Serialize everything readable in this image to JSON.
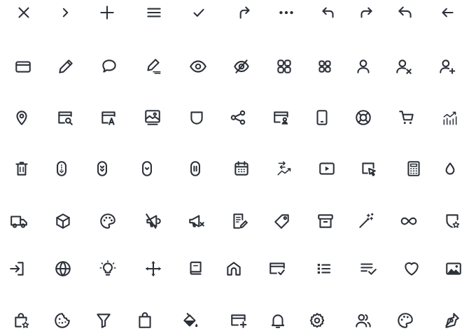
{
  "colors": {
    "background": "#ffffff",
    "icon_stroke": "#2c3038"
  },
  "icon_grid": {
    "rows": [
      [
        "close-icon",
        "chevron-right-icon",
        "plus-icon",
        "menu-icon",
        "check-icon",
        "corner-up-right-icon",
        "more-horizontal-icon",
        "undo-icon",
        "redo-icon",
        "reply-icon",
        "arrow-left-icon"
      ],
      [
        "credit-card-icon",
        "pencil-icon",
        "comment-icon",
        "signature-icon",
        "eye-icon",
        "eye-off-icon",
        "grid-2x2-icon",
        "grid-2x2-small-icon",
        "user-icon",
        "user-remove-icon",
        "user-add-icon"
      ],
      [
        "map-pin-icon",
        "browser-search-icon",
        "browser-text-icon",
        "monitor-image-icon",
        "shield-icon",
        "share-icon",
        "id-card-user-icon",
        "smartphone-icon",
        "lifebuoy-icon",
        "shopping-cart-icon",
        "bar-chart-trend-icon"
      ],
      [
        "trash-icon",
        "scroll-down-icon",
        "scroll-chevrons-icon",
        "scroll-chevron-icon",
        "scroll-pause-icon",
        "calendar-icon",
        "transfer-trend-icon",
        "video-play-icon",
        "cursor-click-icon",
        "calculator-icon",
        "drop-icon"
      ],
      [
        "truck-icon",
        "box-icon",
        "palette-icon",
        "megaphone-off-icon",
        "megaphone-x-icon",
        "document-edit-icon",
        "tag-icon",
        "archive-icon",
        "magic-wand-icon",
        "infinity-icon",
        "shield-star-icon"
      ],
      [
        "login-icon",
        "globe-icon",
        "lightbulb-icon",
        "move-icon",
        "book-icon",
        "home-icon",
        "id-check-icon",
        "list-icon",
        "list-check-icon",
        "heart-icon",
        "image-icon"
      ],
      [
        "bag-star-icon",
        "cookie-icon",
        "filter-icon",
        "shopping-bag-icon",
        "paint-bucket-icon",
        "browser-add-icon",
        "bell-icon",
        "settings-icon",
        "users-icon",
        "palette-alt-icon",
        "pen-tool-icon"
      ]
    ]
  }
}
